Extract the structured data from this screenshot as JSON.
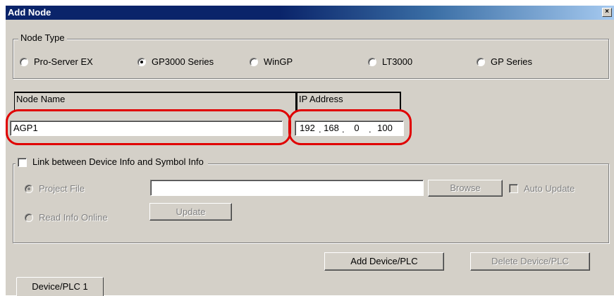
{
  "window": {
    "title": "Add Node",
    "close_glyph": "×"
  },
  "node_type": {
    "legend": "Node Type",
    "options": [
      {
        "label": "Pro-Server EX",
        "checked": false
      },
      {
        "label": "GP3000 Series",
        "checked": true
      },
      {
        "label": "WinGP",
        "checked": false
      },
      {
        "label": "LT3000",
        "checked": false
      },
      {
        "label": "GP Series",
        "checked": false
      }
    ]
  },
  "node_name": {
    "header": "Node Name",
    "value": "AGP1"
  },
  "ip_address": {
    "header": "IP Address",
    "octets": [
      "192",
      "168",
      "0",
      "100"
    ]
  },
  "link": {
    "checkbox_label": "Link between Device Info and Symbol Info",
    "checked": false,
    "project_file": {
      "label": "Project File",
      "checked": true,
      "value": ""
    },
    "browse_label": "Browse",
    "auto_update_label": "Auto Update",
    "read_info_online": {
      "label": "Read Info Online",
      "checked": false
    },
    "update_label": "Update"
  },
  "buttons": {
    "add_device": "Add Device/PLC",
    "delete_device": "Delete Device/PLC"
  },
  "tabs": [
    {
      "label": "Device/PLC 1"
    }
  ],
  "colors": {
    "highlight": "#e00000",
    "title_bar": "#0a246a",
    "dialog_bg": "#d4d0c8"
  }
}
